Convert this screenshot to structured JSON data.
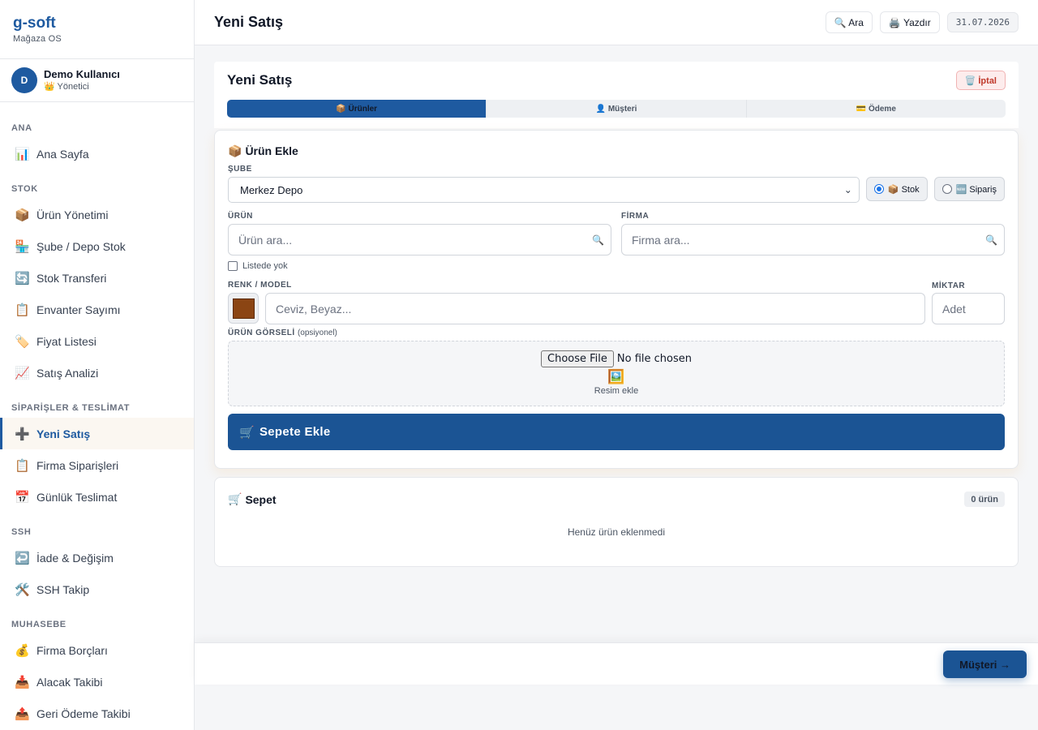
{
  "app": {
    "name": "g-soft",
    "subtitle": "Mağaza OS"
  },
  "user": {
    "initial": "D",
    "name": "Demo Kullanıcı",
    "role": "👑 Yönetici"
  },
  "sidebar": {
    "sections": [
      {
        "title": "ANA",
        "items": [
          {
            "icon": "📊",
            "label": "Ana Sayfa"
          }
        ]
      },
      {
        "title": "STOK",
        "items": [
          {
            "icon": "📦",
            "label": "Ürün Yönetimi"
          },
          {
            "icon": "🏪",
            "label": "Şube / Depo Stok"
          },
          {
            "icon": "🔄",
            "label": "Stok Transferi"
          },
          {
            "icon": "📋",
            "label": "Envanter Sayımı"
          },
          {
            "icon": "🏷️",
            "label": "Fiyat Listesi"
          },
          {
            "icon": "📈",
            "label": "Satış Analizi"
          }
        ]
      },
      {
        "title": "SİPARİŞLER & TESLİMAT",
        "items": [
          {
            "icon": "➕",
            "label": "Yeni Satış",
            "active": true
          },
          {
            "icon": "📋",
            "label": "Firma Siparişleri"
          },
          {
            "icon": "📅",
            "label": "Günlük Teslimat"
          }
        ]
      },
      {
        "title": "SSH",
        "items": [
          {
            "icon": "↩️",
            "label": "İade & Değişim"
          },
          {
            "icon": "🛠️",
            "label": "SSH Takip"
          }
        ]
      },
      {
        "title": "MUHASEBE",
        "items": [
          {
            "icon": "💰",
            "label": "Firma Borçları"
          },
          {
            "icon": "📥",
            "label": "Alacak Takibi"
          },
          {
            "icon": "📤",
            "label": "Geri Ödeme Takibi"
          }
        ]
      }
    ]
  },
  "header": {
    "title": "Yeni Satış",
    "search_label": "🔍 Ara",
    "print_label": "🖨️ Yazdır",
    "date": "31.07.2026"
  },
  "sale": {
    "title": "Yeni Satış",
    "cancel_label": "🗑️ İptal",
    "steps": [
      {
        "label": "📦 Ürünler",
        "active": true
      },
      {
        "label": "👤 Müşteri"
      },
      {
        "label": "💳 Ödeme"
      }
    ]
  },
  "add_product": {
    "title_icon": "📦",
    "title": "Ürün Ekle",
    "branch_label": "ŞUBE",
    "branch_value": "Merkez Depo",
    "radio_stock": "📦 Stok",
    "radio_order": "🆕 Sipariş",
    "selected_mode": "stock",
    "product_label": "ÜRÜN",
    "product_placeholder": "Ürün ara...",
    "company_label": "FİRMA",
    "company_placeholder": "Firma ara...",
    "not_listed_label": "Listede yok",
    "color_label": "RENK / MODEL",
    "color_swatch": "#8b4513",
    "color_placeholder": "Ceviz, Beyaz...",
    "qty_label": "MİKTAR",
    "qty_placeholder": "Adet",
    "image_label": "ÜRÜN GÖRSELİ",
    "image_optional": "(opsiyonel)",
    "choose_file": "Choose File",
    "no_file": "No file chosen",
    "image_icon": "🖼️",
    "image_hint": "Resim ekle",
    "add_button_icon": "🛒",
    "add_button": "Sepete Ekle"
  },
  "cart": {
    "title_icon": "🛒",
    "title": "Sepet",
    "count": "0 ürün",
    "empty": "Henüz ürün eklenmedi"
  },
  "footer": {
    "next_label": "Müşteri →"
  },
  "colors": {
    "accent": "#1e5aa0",
    "button": "#1b5494",
    "danger": "#c0392b"
  }
}
